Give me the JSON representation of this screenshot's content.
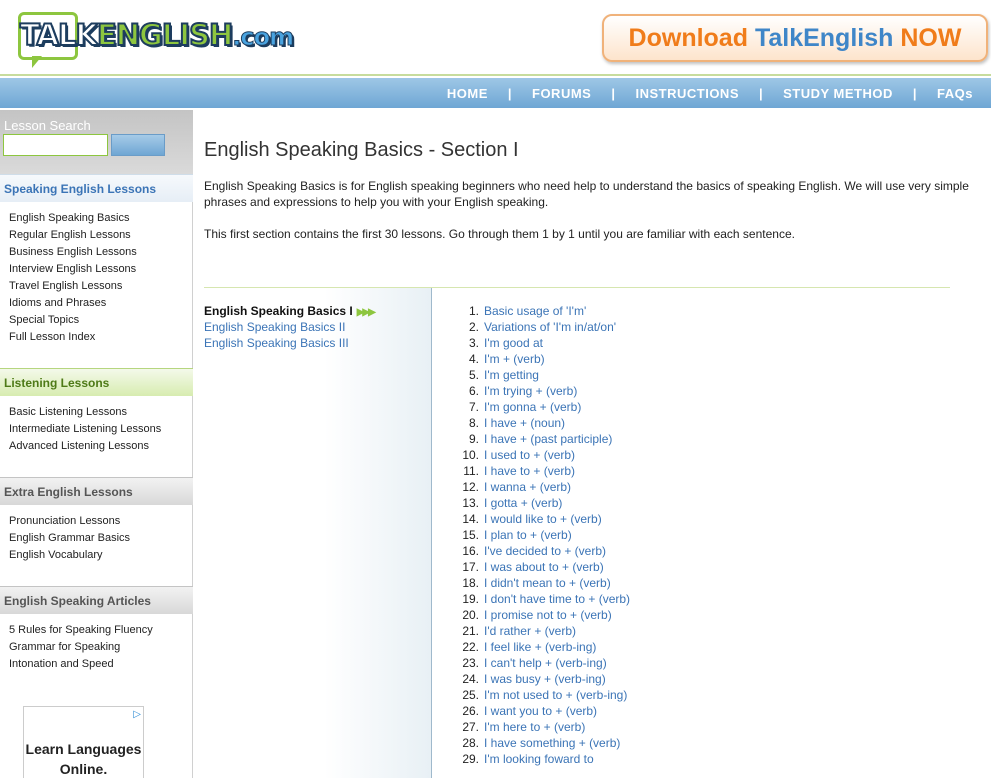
{
  "header": {
    "logo": {
      "part1": "TALK",
      "part2": "ENGLISH",
      "part3": ".com"
    },
    "download": {
      "part1": "Download ",
      "part2": "TalkEnglish",
      "part3": " NOW"
    }
  },
  "nav": {
    "items": [
      "HOME",
      "FORUMS",
      "INSTRUCTIONS",
      "STUDY METHOD",
      "FAQs"
    ],
    "separator": "|"
  },
  "sidebar": {
    "search_label": "Lesson Search",
    "search_value": "",
    "sections": [
      {
        "title": "Speaking English Lessons",
        "items": [
          "English Speaking Basics",
          "Regular English Lessons",
          "Business English Lessons",
          "Interview English Lessons",
          "Travel English Lessons",
          "Idioms and Phrases",
          "Special Topics",
          "Full Lesson Index"
        ]
      },
      {
        "title": "Listening Lessons",
        "items": [
          "Basic Listening Lessons",
          "Intermediate Listening Lessons",
          "Advanced Listening Lessons"
        ]
      },
      {
        "title": "Extra English Lessons",
        "items": [
          "Pronunciation Lessons",
          "English Grammar Basics",
          "English Vocabulary"
        ]
      },
      {
        "title": "English Speaking Articles",
        "items": [
          "5 Rules for Speaking Fluency",
          "Grammar for Speaking",
          "Intonation and Speed"
        ]
      }
    ],
    "ad": {
      "text": "Learn Languages Online.",
      "icon": "adchoices-icon"
    }
  },
  "main": {
    "title": "English Speaking Basics - Section I",
    "intro1": "English Speaking Basics is for English speaking beginners who need help to understand the basics of speaking English. We will use very simple phrases and expressions to help you with your English speaking.",
    "intro2": "This first section contains the first 30 lessons. Go through them 1 by 1 until you are familiar with each sentence.",
    "subnav": {
      "items": [
        "English Speaking Basics I",
        "English Speaking Basics II",
        "English Speaking Basics III"
      ],
      "active_marker": "▶▶▶"
    },
    "lessons": [
      {
        "n": "1.",
        "t": "Basic usage of 'I'm'"
      },
      {
        "n": "2.",
        "t": "Variations of 'I'm in/at/on'"
      },
      {
        "n": "3.",
        "t": "I'm good at"
      },
      {
        "n": "4.",
        "t": "I'm + (verb)"
      },
      {
        "n": "5.",
        "t": "I'm getting"
      },
      {
        "n": "6.",
        "t": "I'm trying + (verb)"
      },
      {
        "n": "7.",
        "t": "I'm gonna + (verb)"
      },
      {
        "n": "8.",
        "t": "I have + (noun)"
      },
      {
        "n": "9.",
        "t": "I have + (past participle)"
      },
      {
        "n": "10.",
        "t": "I used to + (verb)"
      },
      {
        "n": "11.",
        "t": "I have to + (verb)"
      },
      {
        "n": "12.",
        "t": "I wanna + (verb)"
      },
      {
        "n": "13.",
        "t": "I gotta + (verb)"
      },
      {
        "n": "14.",
        "t": "I would like to + (verb)"
      },
      {
        "n": "15.",
        "t": "I plan to + (verb)"
      },
      {
        "n": "16.",
        "t": "I've decided to + (verb)"
      },
      {
        "n": "17.",
        "t": "I was about to + (verb)"
      },
      {
        "n": "18.",
        "t": "I didn't mean to + (verb)"
      },
      {
        "n": "19.",
        "t": "I don't have time to + (verb)"
      },
      {
        "n": "20.",
        "t": "I promise not to + (verb)"
      },
      {
        "n": "21.",
        "t": "I'd rather + (verb)"
      },
      {
        "n": "22.",
        "t": "I feel like + (verb-ing)"
      },
      {
        "n": "23.",
        "t": "I can't help + (verb-ing)"
      },
      {
        "n": "24.",
        "t": "I was busy + (verb-ing)"
      },
      {
        "n": "25.",
        "t": "I'm not used to + (verb-ing)"
      },
      {
        "n": "26.",
        "t": "I want you to + (verb)"
      },
      {
        "n": "27.",
        "t": "I'm here to + (verb)"
      },
      {
        "n": "28.",
        "t": "I have something + (verb)"
      },
      {
        "n": "29.",
        "t": "I'm looking foward to"
      }
    ]
  }
}
